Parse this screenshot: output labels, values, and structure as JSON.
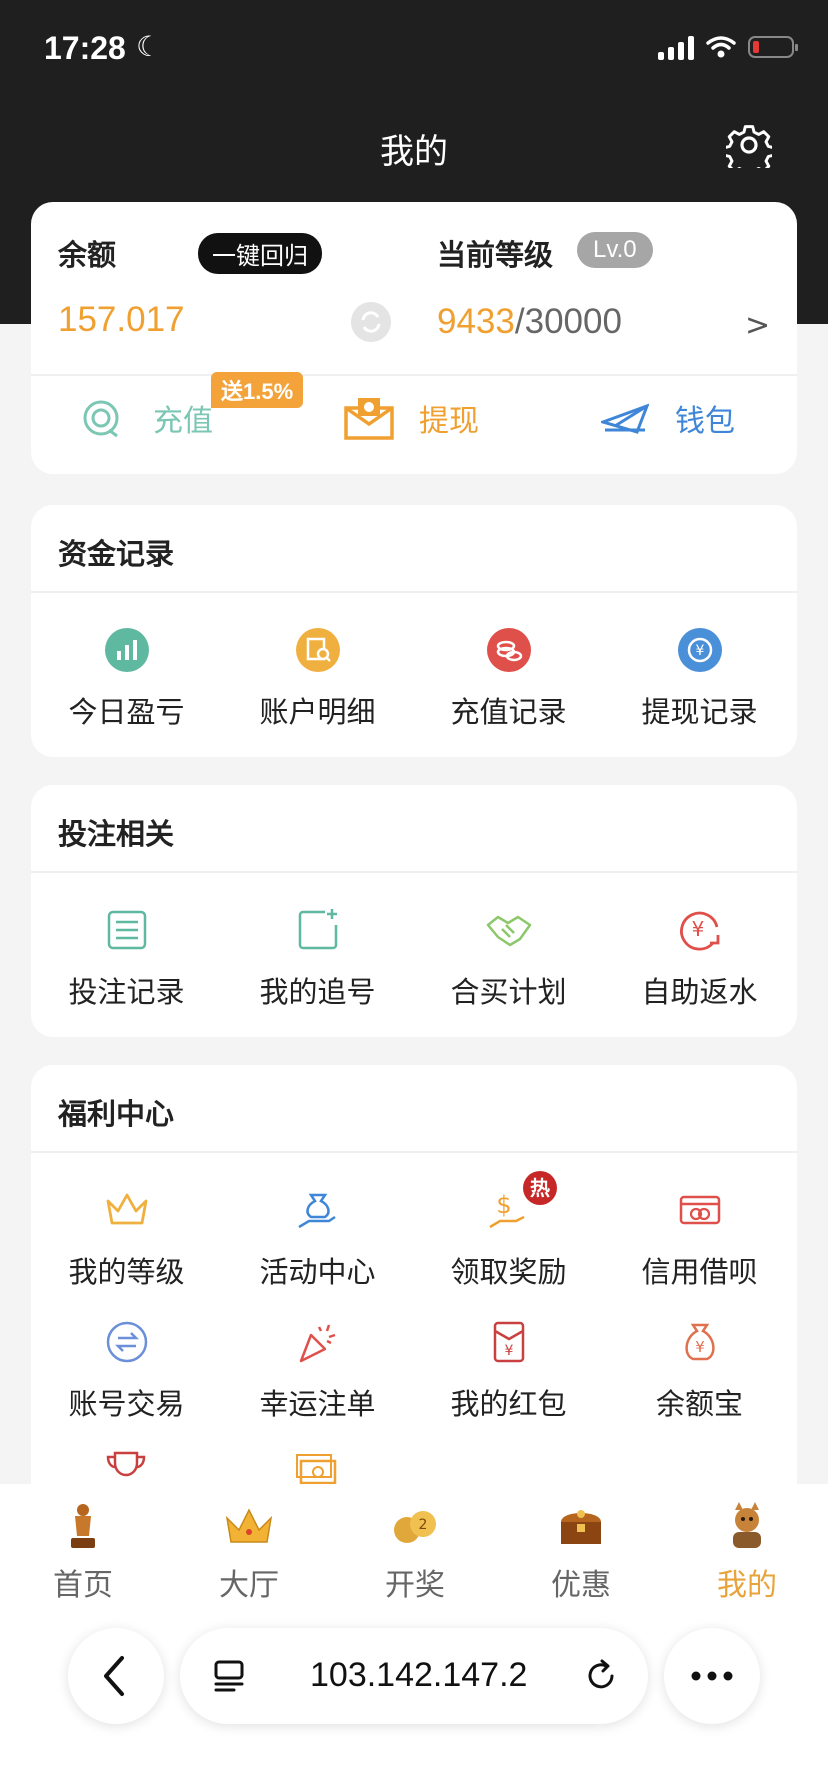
{
  "status_bar": {
    "time": "17:28"
  },
  "header": {
    "title": "我的"
  },
  "balance": {
    "label": "余额",
    "return_button": "一键回归",
    "value": "157.017",
    "level_label": "当前等级",
    "level_badge": "Lv.0",
    "level_current": "9433",
    "level_sep": "/",
    "level_target": "30000",
    "arrow": ">"
  },
  "actions": {
    "recharge": "充值",
    "recharge_bonus": "送1.5%",
    "withdraw": "提现",
    "wallet": "钱包"
  },
  "fund_records": {
    "title": "资金记录",
    "items": [
      "今日盈亏",
      "账户明细",
      "充值记录",
      "提现记录"
    ]
  },
  "betting": {
    "title": "投注相关",
    "items": [
      "投注记录",
      "我的追号",
      "合买计划",
      "自助返水"
    ]
  },
  "welfare": {
    "title": "福利中心",
    "items": [
      "我的等级",
      "活动中心",
      "领取奖励",
      "信用借呗",
      "账号交易",
      "幸运注单",
      "我的红包",
      "余额宝"
    ],
    "hot_badge": "热"
  },
  "tabs": [
    "首页",
    "大厅",
    "开奖",
    "优惠",
    "我的"
  ],
  "browser": {
    "url": "103.142.147.2"
  },
  "colors": {
    "accent": "#f0a030",
    "dark": "#1f1f1f",
    "teal": "#5fb8a0",
    "blue": "#3f86d8",
    "red": "#e0504a"
  }
}
